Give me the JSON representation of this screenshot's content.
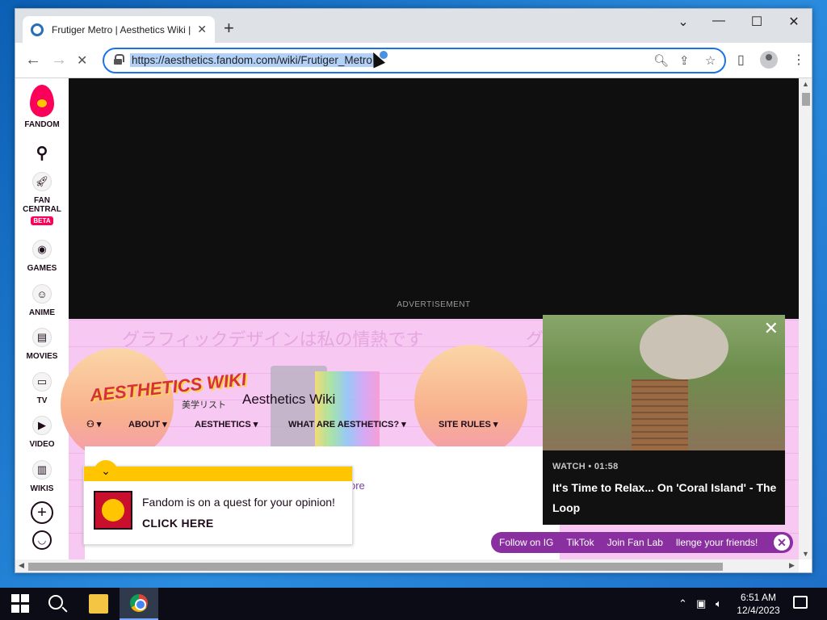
{
  "browser": {
    "tab_title": "Frutiger Metro | Aesthetics Wiki | Fandom",
    "tab_close": "✕",
    "new_tab": "+",
    "url": "https://aesthetics.fandom.com/wiki/Frutiger_Metro",
    "win_controls": {
      "dropdown": "⌄",
      "minimize": "—",
      "maximize": "☐",
      "close": "✕"
    }
  },
  "fandom_sidebar": {
    "brand": "FANDOM",
    "items": [
      {
        "label": "FAN CENTRAL",
        "icon": "rocket-icon",
        "badge": "BETA"
      },
      {
        "label": "GAMES",
        "icon": "gamepad-icon"
      },
      {
        "label": "ANIME",
        "icon": "anime-icon"
      },
      {
        "label": "MOVIES",
        "icon": "film-icon"
      },
      {
        "label": "TV",
        "icon": "tv-icon"
      },
      {
        "label": "VIDEO",
        "icon": "play-icon"
      },
      {
        "label": "WIKIS",
        "icon": "book-icon"
      }
    ]
  },
  "ad": {
    "label": "ADVERTISEMENT"
  },
  "wiki": {
    "banner_jp": "グラフィックデザインは私の情熱です",
    "banner_jp_partial": "グ",
    "logo_text": "AESTHETICS WIKI",
    "logo_sub": "美学リスト",
    "name": "Aesthetics Wiki",
    "nav": [
      "ABOUT",
      "AESTHETICS",
      "WHAT ARE AESTHETICS?",
      "SITE RULES"
    ],
    "explore_more": "ore"
  },
  "quest": {
    "message": "Fandom is on a quest for your opinion!",
    "cta": "CLICK HERE"
  },
  "video": {
    "meta": "WATCH • 01:58",
    "title": "It's Time to Relax... On 'Coral Island' - The Loop"
  },
  "social_bar": {
    "items": [
      "Follow on IG",
      "TikTok",
      "Join Fan Lab",
      "llenge your friends!"
    ]
  },
  "taskbar": {
    "time": "6:51 AM",
    "date": "12/4/2023"
  }
}
